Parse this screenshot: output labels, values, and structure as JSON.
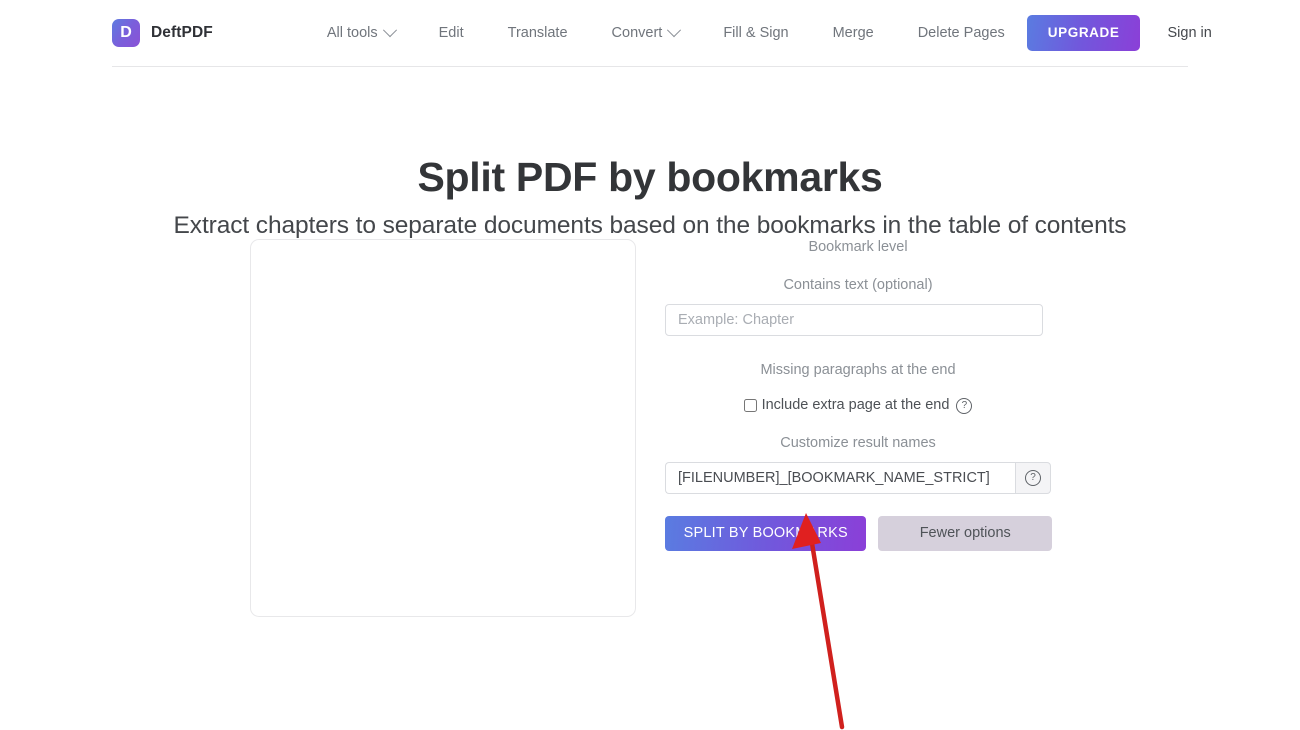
{
  "navbar": {
    "brand": {
      "mark": "D",
      "name": "DeftPDF"
    },
    "links": [
      {
        "label": "All tools",
        "has_caret": true
      },
      {
        "label": "Edit",
        "has_caret": false
      },
      {
        "label": "Translate",
        "has_caret": false
      },
      {
        "label": "Convert",
        "has_caret": true
      },
      {
        "label": "Fill & Sign",
        "has_caret": false
      },
      {
        "label": "Merge",
        "has_caret": false
      },
      {
        "label": "Delete Pages",
        "has_caret": false
      }
    ],
    "upgrade_label": "UPGRADE",
    "sign_in_label": "Sign in"
  },
  "page": {
    "title": "Split PDF by bookmarks",
    "subtitle": "Extract chapters to separate documents based on the bookmarks in the table of contents"
  },
  "options": {
    "bookmark_level_label": "Bookmark level",
    "contains_text_label": "Contains text (optional)",
    "contains_text_placeholder": "Example: Chapter",
    "contains_text_value": "",
    "missing_paragraphs_label": "Missing paragraphs at the end",
    "include_extra_page_label": "Include extra page at the end",
    "include_extra_page_checked": false,
    "help_icon_glyph": "?",
    "customize_result_names_label": "Customize result names",
    "result_names_value": "[FILENUMBER]_[BOOKMARK_NAME_STRICT]",
    "result_names_placeholder": "[FILENUMBER]_[BOOKMARK_NAME_STRICT]",
    "split_button_label": "SPLIT BY BOOKMARKS",
    "fewer_options_label": "Fewer options"
  },
  "colors": {
    "gradient_start": "#5a7ce1",
    "gradient_mid": "#7158dc",
    "gradient_end": "#8b3fd8",
    "secondary_button": "#d6d0dc",
    "annotation_arrow": "#d0201d",
    "title_text": "#333538",
    "muted_text": "#8b9096"
  }
}
